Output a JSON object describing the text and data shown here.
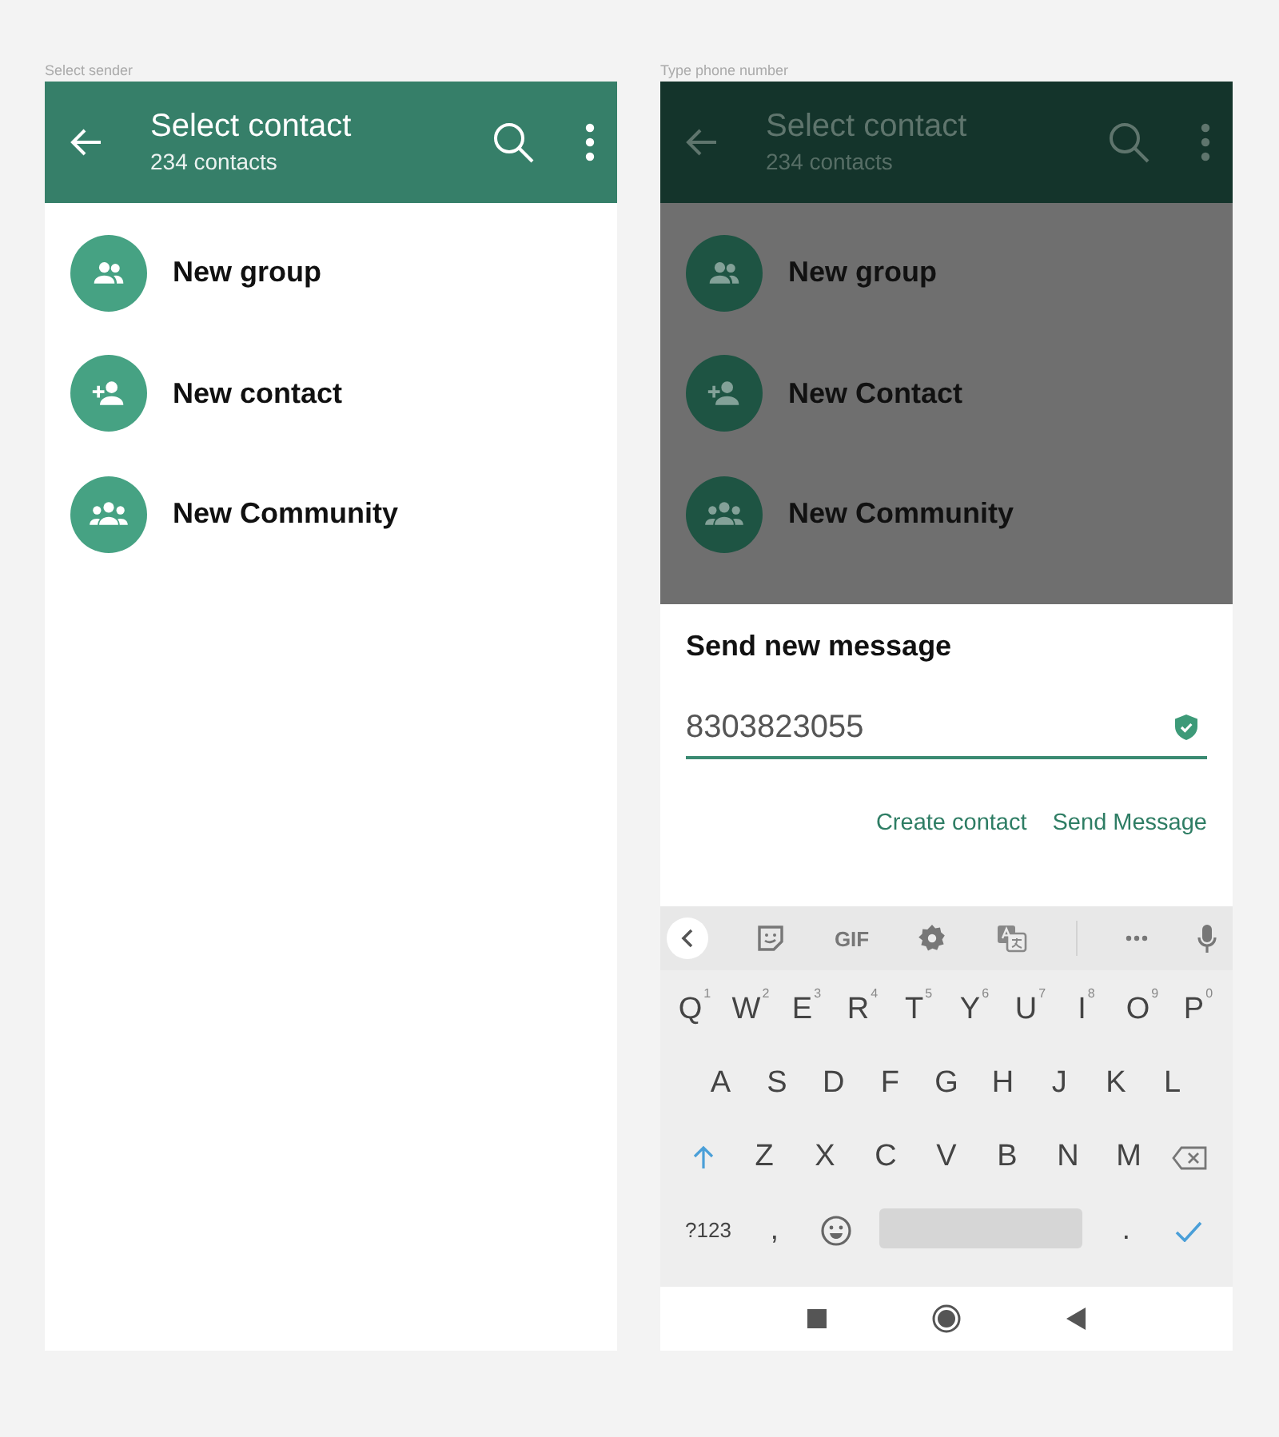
{
  "panels": [
    {
      "caption": "Select sender",
      "dimmed": false,
      "header": {
        "title": "Select contact",
        "subtitle": "234 contacts"
      },
      "items": [
        {
          "kind": "group",
          "label": "New group"
        },
        {
          "kind": "add-person",
          "label": "New contact"
        },
        {
          "kind": "community",
          "label": "New Community"
        }
      ]
    },
    {
      "caption": "Type phone number",
      "dimmed": true,
      "header": {
        "title": "Select contact",
        "subtitle": "234 contacts"
      },
      "items": [
        {
          "kind": "group",
          "label": "New group"
        },
        {
          "kind": "add-person",
          "label": "New Contact"
        },
        {
          "kind": "community",
          "label": "New Community"
        }
      ],
      "dialog": {
        "title": "Send new message",
        "value": "8303823055",
        "verified": true,
        "actions": [
          "Create contact",
          "Send Message"
        ]
      },
      "keyboard": {
        "toolbar": [
          {
            "kind": "back"
          },
          {
            "kind": "sticker"
          },
          {
            "kind": "text",
            "label": "GIF"
          },
          {
            "kind": "settings"
          },
          {
            "kind": "translate"
          },
          {
            "kind": "divider"
          },
          {
            "kind": "more"
          },
          {
            "kind": "mic"
          }
        ],
        "rows": [
          [
            {
              "kind": "char",
              "label": "Q",
              "hint": "1"
            },
            {
              "kind": "char",
              "label": "W",
              "hint": "2"
            },
            {
              "kind": "char",
              "label": "E",
              "hint": "3"
            },
            {
              "kind": "char",
              "label": "R",
              "hint": "4"
            },
            {
              "kind": "char",
              "label": "T",
              "hint": "5"
            },
            {
              "kind": "char",
              "label": "Y",
              "hint": "6"
            },
            {
              "kind": "char",
              "label": "U",
              "hint": "7"
            },
            {
              "kind": "char",
              "label": "I",
              "hint": "8"
            },
            {
              "kind": "char",
              "label": "O",
              "hint": "9"
            },
            {
              "kind": "char",
              "label": "P",
              "hint": "0"
            }
          ],
          [
            {
              "kind": "char",
              "label": "A"
            },
            {
              "kind": "char",
              "label": "S"
            },
            {
              "kind": "char",
              "label": "D"
            },
            {
              "kind": "char",
              "label": "F"
            },
            {
              "kind": "char",
              "label": "G"
            },
            {
              "kind": "char",
              "label": "H"
            },
            {
              "kind": "char",
              "label": "J"
            },
            {
              "kind": "char",
              "label": "K"
            },
            {
              "kind": "char",
              "label": "L"
            }
          ],
          [
            {
              "kind": "shift"
            },
            {
              "kind": "char",
              "label": "Z"
            },
            {
              "kind": "char",
              "label": "X"
            },
            {
              "kind": "char",
              "label": "C"
            },
            {
              "kind": "char",
              "label": "V"
            },
            {
              "kind": "char",
              "label": "B"
            },
            {
              "kind": "char",
              "label": "N"
            },
            {
              "kind": "char",
              "label": "M"
            },
            {
              "kind": "backspace"
            }
          ],
          [
            {
              "kind": "small",
              "label": "?123"
            },
            {
              "kind": "char",
              "label": ","
            },
            {
              "kind": "emoji"
            },
            {
              "kind": "space"
            },
            {
              "kind": "char",
              "label": "."
            },
            {
              "kind": "enter"
            }
          ]
        ]
      },
      "nav_bar": [
        {
          "kind": "recents"
        },
        {
          "kind": "home"
        },
        {
          "kind": "back"
        }
      ]
    }
  ]
}
